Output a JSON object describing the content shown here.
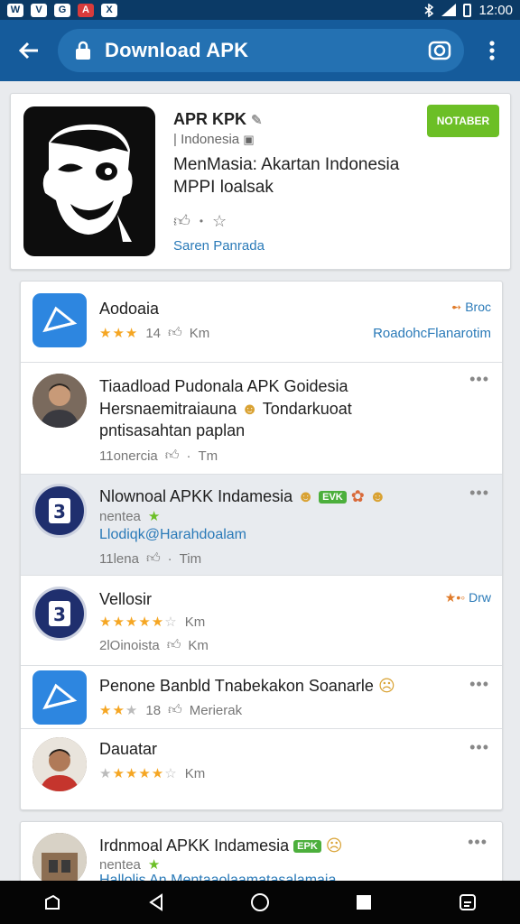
{
  "status_bar": {
    "time": "12:00",
    "icons": [
      "W",
      "V",
      "G",
      "A",
      "X"
    ]
  },
  "app_bar": {
    "title": "Download APK"
  },
  "header": {
    "app_name": "APR KPK",
    "country": "Indonesia",
    "description_line1": "MenMasia: Akartan Indonesia",
    "description_line2": "MPPI loalsak",
    "link": "Saren Panrada",
    "install_label": "NOTABER"
  },
  "list": [
    {
      "title": "Aodoaia",
      "rating_count": "14",
      "meta_tail": "Km",
      "link": "RoadohcFlanarotim",
      "tag": "Broc"
    },
    {
      "title": "Tiaadload Pudonala APK Goidesia",
      "line2": "Hersnaemitraiauna",
      "line2_tail": "Tondarkuoat",
      "line3": "pntisasahtan paplan",
      "meta": "11onercia",
      "meta_tail": "Tm"
    },
    {
      "title": "Nlownoal APKK Indamesia",
      "badge": "EVK",
      "sub": "nentea",
      "link": "Llodiqk@Harahdoalam",
      "meta": "11lena",
      "meta_tail": "Tim"
    },
    {
      "title": "Vellosir",
      "meta_tail": "Km",
      "meta": "2lOinoista",
      "meta2_tail": "Km",
      "tag": "Drw"
    },
    {
      "title": "Penone Banbld Tnabekakon Soanarle",
      "rating_count": "18",
      "meta_tail": "Merierak"
    },
    {
      "title": "Dauatar",
      "meta_tail": "Km"
    }
  ],
  "bottom_item": {
    "title": "Irdnmoal APKK Indamesia",
    "badge": "EPK",
    "sub": "nentea",
    "link": "Hallolis An Mentaaolaamatasalamaia"
  },
  "colors": {
    "app_bar": "#155b9b",
    "status_bar": "#0b3a66",
    "accent_green": "#6cbf26",
    "link_blue": "#2a7ab8",
    "star": "#f5a623"
  }
}
